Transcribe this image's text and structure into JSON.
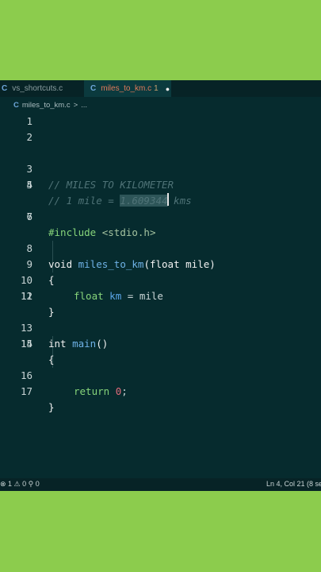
{
  "tabs": [
    {
      "icon": "C",
      "label": "vs_shortcuts.c"
    },
    {
      "icon": "C",
      "label": "miles_to_km.c",
      "badge": "1",
      "dirty": "●"
    }
  ],
  "breadcrumb": {
    "icon": "C",
    "file": "miles_to_km.c",
    "sep": ">",
    "rest": "..."
  },
  "line_numbers": [
    "1",
    "2",
    "3",
    "4",
    "5",
    "6",
    "7",
    "8",
    "9",
    "10",
    "11",
    "12",
    "13",
    "14",
    "15",
    "16",
    "17"
  ],
  "code": {
    "l3": "// MILES TO KILOMETER",
    "l4_pre": "// 1 mile = ",
    "l4_sel": "1.609344",
    "l4_post": " kms",
    "l6_inc": "#include",
    "l6_hdr": "<stdio.h>",
    "l8_kw": "void",
    "l8_fn": "miles_to_km",
    "l8_p1": "(",
    "l8_type": "float",
    "l8_param": "mile",
    "l8_p2": ")",
    "l9": "{",
    "l10_type": "float",
    "l10_var": "km",
    "l10_eq": "=",
    "l10_val": "mile",
    "l11": "}",
    "l13_kw": "int",
    "l13_fn": "main",
    "l13_p": "()",
    "l14": "{",
    "l16_ret": "return",
    "l16_num": "0",
    "l16_semi": ";",
    "l17": "}"
  },
  "status": {
    "left": "⊗ 1 ⚠ 0   ⚲ 0",
    "right": "Ln 4, Col 21 (8 se"
  },
  "colors": {
    "editor_bg": "#062b2e",
    "frame_bg": "#8ccc4d",
    "active_tab": "#e07a5a"
  }
}
